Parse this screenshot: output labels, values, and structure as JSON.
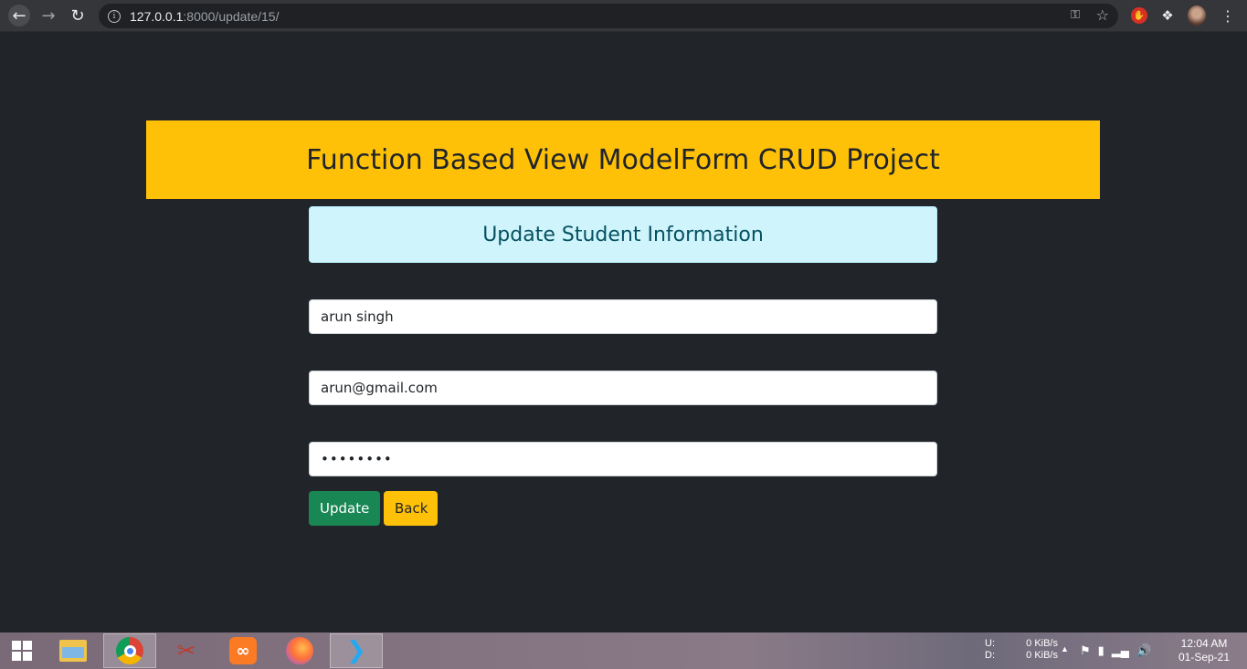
{
  "browser": {
    "url_host": "127.0.0.1",
    "url_path": ":8000/update/15/"
  },
  "page": {
    "banner_title": "Function Based View ModelForm CRUD Project",
    "panel_title": "Update Student Information",
    "form": {
      "name_value": "arun singh",
      "email_value": "arun@gmail.com",
      "password_value": "12345678"
    },
    "buttons": {
      "update_label": "Update",
      "back_label": "Back"
    }
  },
  "taskbar": {
    "net_up_label": "U:",
    "net_up_value": "0 KiB/s",
    "net_down_label": "D:",
    "net_down_value": "0 KiB/s",
    "time": "12:04 AM",
    "date": "01-Sep-21"
  },
  "colors": {
    "banner": "#ffc107",
    "panel": "#cff4fc",
    "update_button": "#198754",
    "back_button": "#ffc107",
    "page_background": "#212529"
  }
}
